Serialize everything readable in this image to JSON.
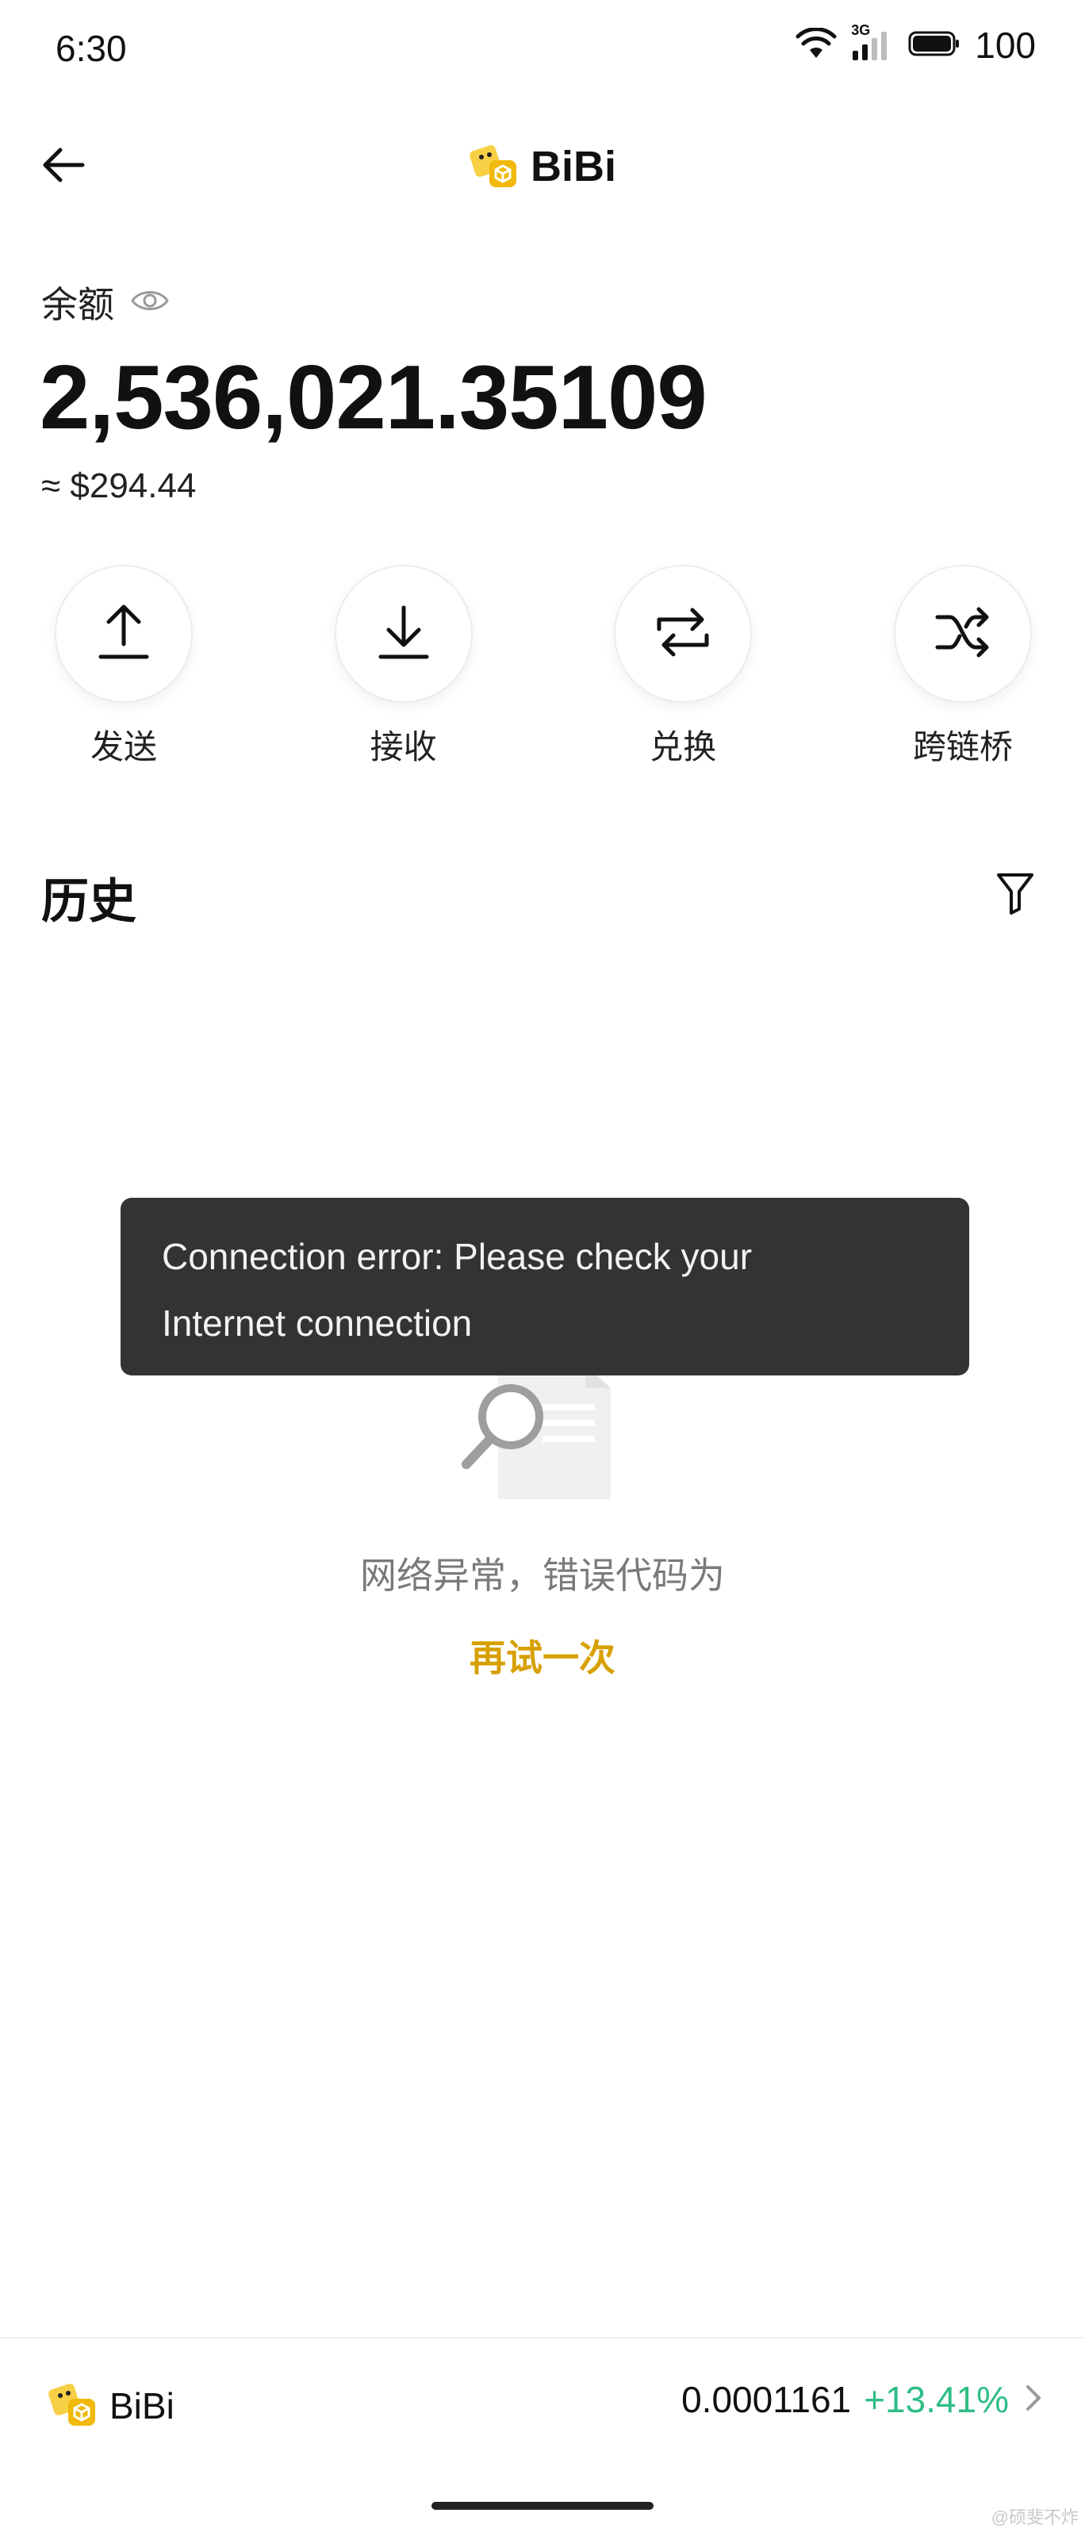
{
  "status_bar": {
    "time": "6:30",
    "network_label": "3G",
    "battery_level": "100"
  },
  "header": {
    "title": "BiBi",
    "back_icon": "arrow-left-icon",
    "logo_icon": "bibi-logo-icon"
  },
  "balance": {
    "label": "余额",
    "amount": "2,536,021.35109",
    "usd_value": "≈ $294.44",
    "visibility_icon": "eye-icon"
  },
  "actions": [
    {
      "label": "发送",
      "icon": "upload-arrow-icon"
    },
    {
      "label": "接收",
      "icon": "download-arrow-icon"
    },
    {
      "label": "兑换",
      "icon": "swap-icon"
    },
    {
      "label": "跨链桥",
      "icon": "shuffle-icon"
    }
  ],
  "history": {
    "title": "历史",
    "filter_icon": "filter-icon",
    "empty_message": "网络异常，错误代码为",
    "retry_label": "再试一次"
  },
  "toast": {
    "line1": "Connection error: Please check your",
    "line2": "Internet connection"
  },
  "bottom_bar": {
    "token_name": "BiBi",
    "price": "0.0001161",
    "change": "+13.41%",
    "change_color": "#2ebd85"
  },
  "colors": {
    "accent": "#d7a000",
    "toast_bg": "#333333",
    "positive": "#2ebd85"
  },
  "watermark": "@硕斐不炸"
}
